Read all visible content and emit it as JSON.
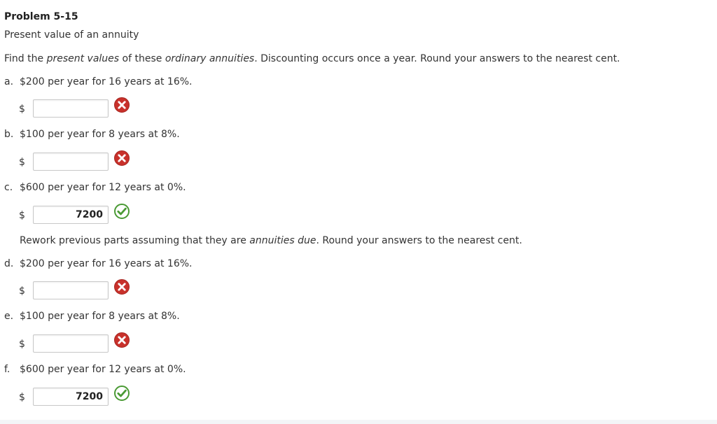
{
  "problem": {
    "title": "Problem 5-15",
    "subtitle": "Present value of an annuity",
    "instructions_1": {
      "t1": "Find the ",
      "e1": "present values",
      "t2": " of these ",
      "e2": "ordinary annuities",
      "t3": ". Discounting occurs once a year. Round your answers to the nearest cent."
    },
    "instructions_2": {
      "t1": "Rework previous parts assuming that they are ",
      "e1": "annuities due",
      "t2": ". Round your answers to the nearest cent."
    }
  },
  "currency_symbol": "$",
  "parts": [
    {
      "letter": "a.",
      "text": "$200 per year for 16 years at 16%.",
      "value": "",
      "status": "incorrect"
    },
    {
      "letter": "b.",
      "text": "$100 per year for 8 years at 8%.",
      "value": "",
      "status": "incorrect"
    },
    {
      "letter": "c.",
      "text": "$600 per year for 12 years at 0%.",
      "value": "7200",
      "status": "correct"
    },
    {
      "letter": "d.",
      "text": "$200 per year for 16 years at 16%.",
      "value": "",
      "status": "incorrect"
    },
    {
      "letter": "e.",
      "text": "$100 per year for 8 years at 8%.",
      "value": "",
      "status": "incorrect"
    },
    {
      "letter": "f.",
      "text": "$600 per year for 12 years at 0%.",
      "value": "7200",
      "status": "correct"
    }
  ],
  "icons": {
    "incorrect": "x-circle-icon",
    "correct": "check-circle-icon"
  },
  "colors": {
    "incorrect": "#c8312b",
    "correct": "#4a9a34"
  }
}
